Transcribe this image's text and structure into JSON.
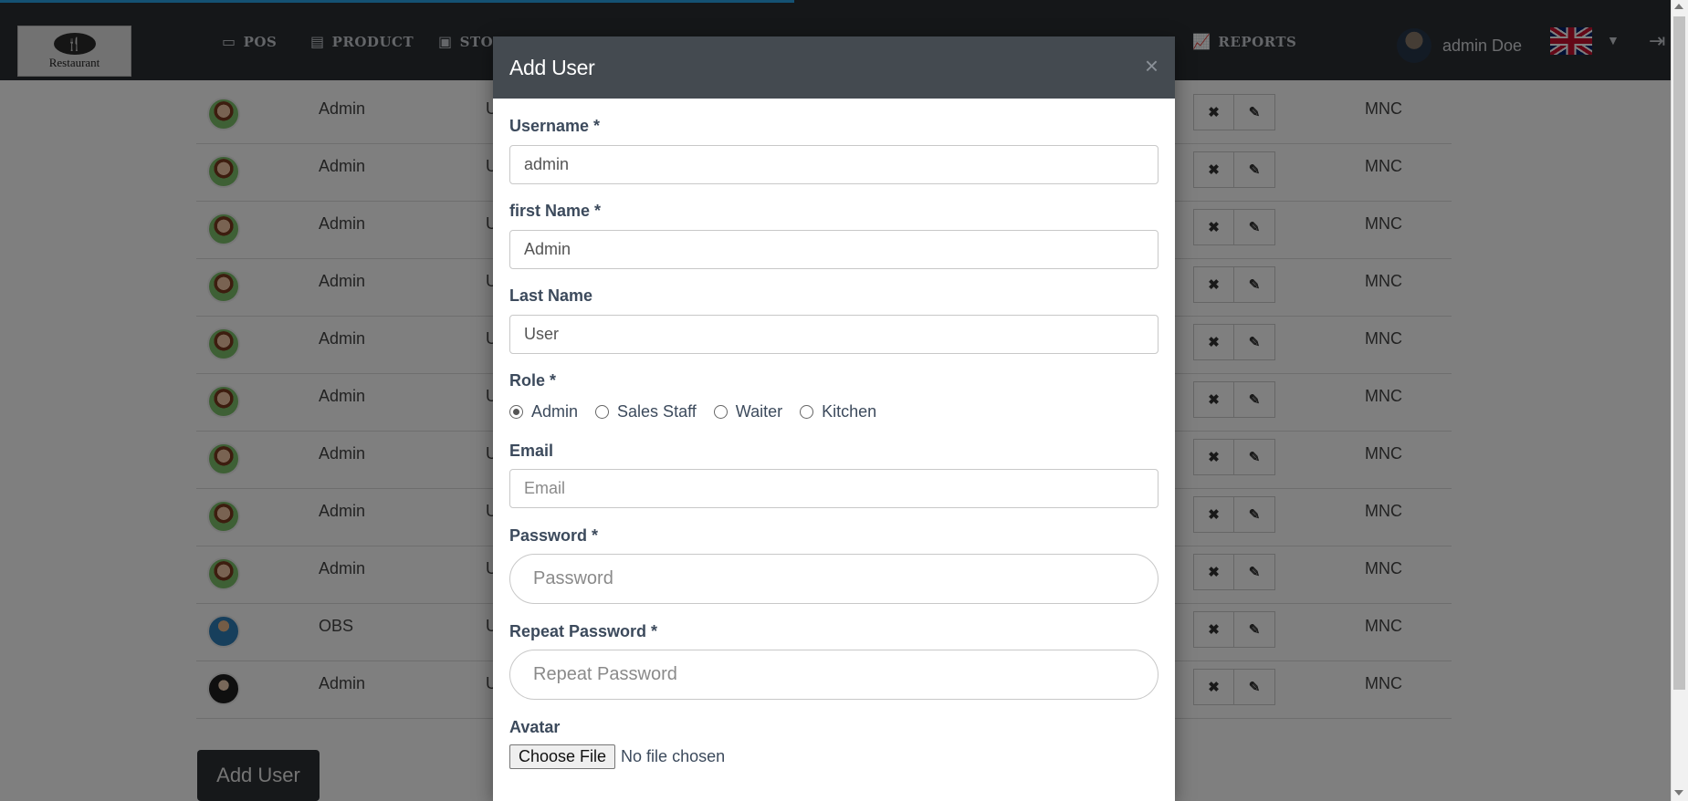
{
  "navbar": {
    "logo_text": "Restaurant",
    "items": [
      {
        "label": "POS",
        "icon": "credit-card-icon"
      },
      {
        "label": "PRODUCT",
        "icon": "archive-icon"
      },
      {
        "label": "STO",
        "icon": "clipboard-icon"
      },
      {
        "label": "REPORTS",
        "icon": "line-chart-icon"
      }
    ],
    "user_name": "admin Doe",
    "language_flag": "uk-flag-icon"
  },
  "table": {
    "rows": [
      {
        "name": "Admin",
        "col2": "U",
        "org": "MNC",
        "avatar": "female"
      },
      {
        "name": "Admin",
        "col2": "U",
        "org": "MNC",
        "avatar": "female"
      },
      {
        "name": "Admin",
        "col2": "U",
        "org": "MNC",
        "avatar": "female"
      },
      {
        "name": "Admin",
        "col2": "U",
        "org": "MNC",
        "avatar": "female"
      },
      {
        "name": "Admin",
        "col2": "U",
        "org": "MNC",
        "avatar": "female"
      },
      {
        "name": "Admin",
        "col2": "U",
        "org": "MNC",
        "avatar": "female"
      },
      {
        "name": "Admin",
        "col2": "U",
        "org": "MNC",
        "avatar": "female"
      },
      {
        "name": "Admin",
        "col2": "U",
        "org": "MNC",
        "avatar": "female"
      },
      {
        "name": "Admin",
        "col2": "U",
        "org": "MNC",
        "avatar": "female"
      },
      {
        "name": "OBS",
        "col2": "U",
        "org": "MNC",
        "avatar": "male"
      },
      {
        "name": "Admin",
        "col2": "U",
        "org": "MNC",
        "avatar": "woman-dark"
      }
    ],
    "delete_icon": "✖",
    "edit_icon": "✎",
    "add_user_label": "Add User"
  },
  "modal": {
    "title": "Add User",
    "close_glyph": "×",
    "username_label": "Username *",
    "username_value": "admin",
    "first_name_label": "first Name *",
    "first_name_value": "Admin",
    "last_name_label": "Last Name",
    "last_name_value": "User",
    "role_label": "Role *",
    "roles": [
      {
        "label": "Admin",
        "checked": true
      },
      {
        "label": "Sales Staff",
        "checked": false
      },
      {
        "label": "Waiter",
        "checked": false
      },
      {
        "label": "Kitchen",
        "checked": false
      }
    ],
    "email_label": "Email",
    "email_placeholder": "Email",
    "password_label": "Password *",
    "password_placeholder": "Password",
    "repeat_password_label": "Repeat Password *",
    "repeat_password_placeholder": "Repeat Password",
    "avatar_label": "Avatar",
    "file_button": "Choose File",
    "file_status": "No file chosen"
  }
}
